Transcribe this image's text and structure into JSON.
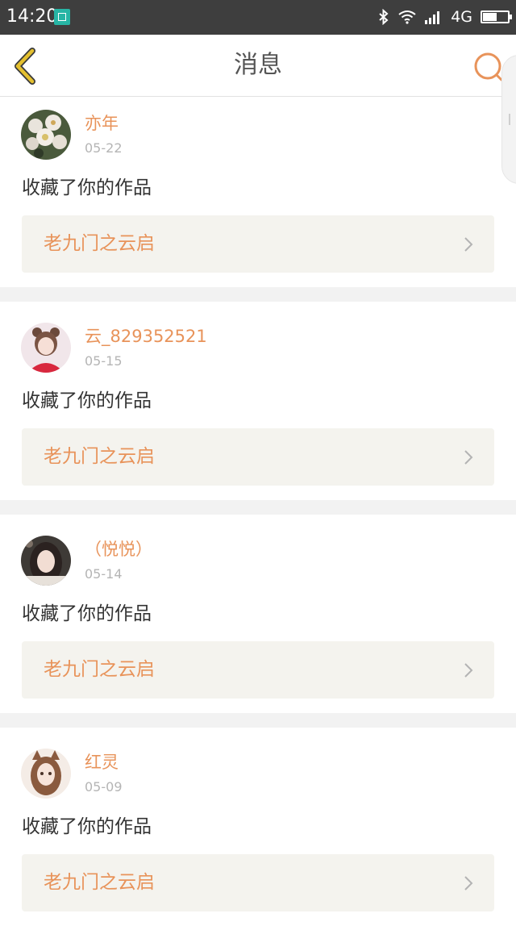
{
  "status_bar": {
    "time": "14:20",
    "network": "4G",
    "battery_level": 0.55,
    "screenshot_icon": "screenshot-icon",
    "bluetooth_icon": "bluetooth-icon",
    "wifi_icon": "wifi-icon",
    "signal_icon": "signal-icon"
  },
  "header": {
    "title": "消息",
    "back_icon": "back-chevron-icon",
    "search_icon": "search-icon",
    "accent_color": "#e8935a",
    "back_color": "#e4c02f"
  },
  "messages": [
    {
      "username": "亦年",
      "date": "05-22",
      "action": "收藏了你的作品",
      "work_title": "老九门之云启",
      "avatar": "flowers-avatar"
    },
    {
      "username": "云_829352521",
      "date": "05-15",
      "action": "收藏了你的作品",
      "work_title": "老九门之云启",
      "avatar": "girl-avatar"
    },
    {
      "username": "（悦悦）",
      "date": "05-14",
      "action": "收藏了你的作品",
      "work_title": "老九门之云启",
      "avatar": "selfie-avatar"
    },
    {
      "username": "红灵",
      "date": "05-09",
      "action": "收藏了你的作品",
      "work_title": "老九门之云启",
      "avatar": "illustration-avatar"
    }
  ]
}
